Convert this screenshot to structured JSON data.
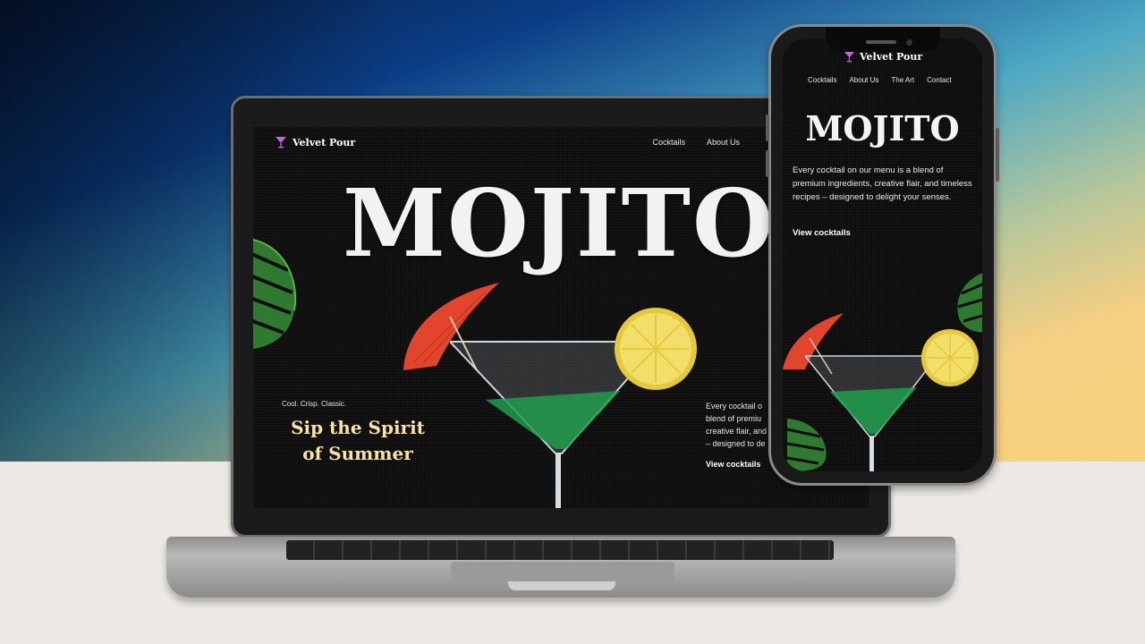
{
  "brand": {
    "name": "Velvet Pour",
    "logo_icon": "cocktail-glass-icon",
    "accent_color": "#f7e4a2",
    "logo_color": "#b86bd6"
  },
  "nav": {
    "items": [
      "Cocktails",
      "About Us",
      "The Art",
      "Contact"
    ]
  },
  "hero": {
    "title": "MOJITO",
    "tagline": "Cool. Crisp. Classic.",
    "headline": "Sip the Spirit of Summer",
    "description": "Every cocktail on our menu is a blend of premium ingredients, creative flair, and timeless recipes – designed to delight your senses.",
    "cta_label": "View cocktails"
  },
  "laptop_view": {
    "visible_nav": [
      "Cocktails",
      "About Us"
    ],
    "description_lines": [
      "Every cocktail o",
      "blend of premiu",
      "creative flair, and",
      "– designed to de"
    ]
  }
}
